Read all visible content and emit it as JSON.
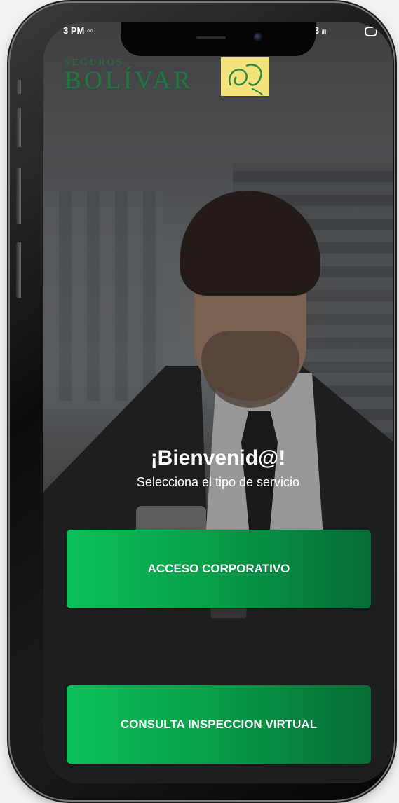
{
  "status_bar": {
    "time": "3 PM ◦◦",
    "right_text": "3 ᵢₗₗ"
  },
  "logo": {
    "small_text": "SEGUROS",
    "main_text": "BOLÍVAR",
    "brand_color": "#1d7a3e",
    "mark_color": "#f3e37a"
  },
  "welcome": {
    "title": "¡Bienvenid@!",
    "subtitle": "Selecciona el tipo de servicio"
  },
  "buttons": {
    "corporate_label": "ACCESO CORPORATIVO",
    "inspection_label": "CONSULTA INSPECCION VIRTUAL",
    "gradient_start": "#0dc05a",
    "gradient_end": "#066b34"
  }
}
